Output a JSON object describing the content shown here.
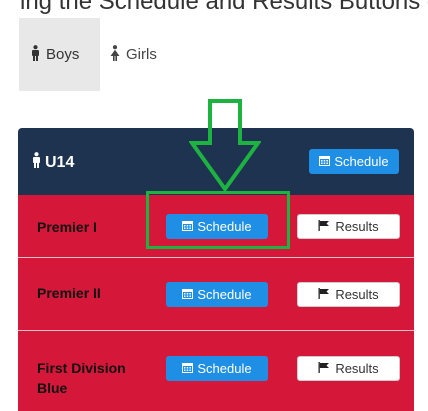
{
  "top_crop_text": "ing the Schedule and Results Buttons on the Bracket Play",
  "tabs": [
    {
      "label": "Boys",
      "active": true
    },
    {
      "label": "Girls",
      "active": false
    }
  ],
  "panel": {
    "title": "U14",
    "schedule_label": "Schedule",
    "rows": [
      {
        "label": "Premier I",
        "schedule": "Schedule",
        "results": "Results"
      },
      {
        "label": "Premier II",
        "schedule": "Schedule",
        "results": "Results"
      },
      {
        "label": "First Division Blue",
        "schedule": "Schedule",
        "results": "Results"
      }
    ]
  },
  "colors": {
    "header_bg": "#1e3350",
    "row_bg": "#d5183a",
    "button_blue": "#1f8fe5",
    "highlight_green": "#1db340"
  },
  "icons": {
    "boy": "male-person-icon",
    "girl": "female-person-icon",
    "calendar": "calendar-icon",
    "flag": "flag-icon",
    "annotation": "down-arrow-icon"
  }
}
